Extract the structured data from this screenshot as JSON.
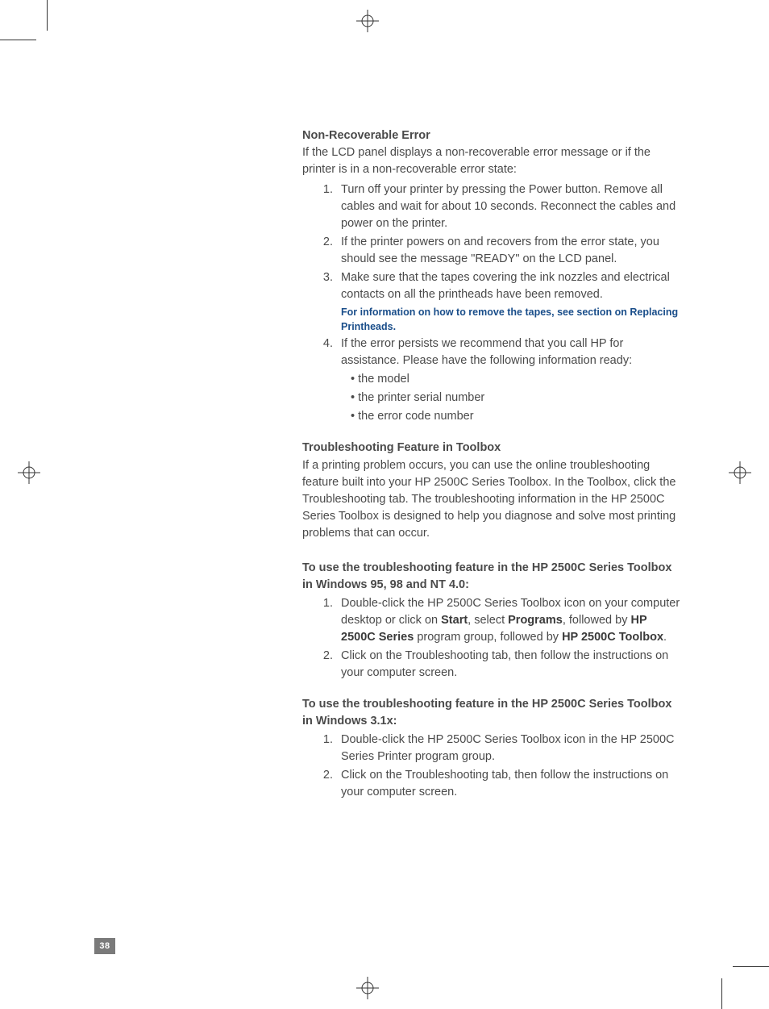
{
  "pageNumber": "38",
  "section1": {
    "heading": "Non-Recoverable Error",
    "intro": "If the LCD panel displays a non-recoverable error message or if the printer is in a non-recoverable error state:",
    "items": [
      "Turn off your printer by pressing the Power button. Remove all cables and wait for about 10 seconds. Reconnect the cables and power on the printer.",
      "If the printer powers on and recovers from the error state, you should see the message \"READY\" on the LCD panel.",
      "Make sure that the tapes covering the ink nozzles and electrical contacts on all the printheads have been removed."
    ],
    "note": "For information on how to remove the tapes, see section on Replacing Printheads.",
    "item4_lead": "If the error persists we recommend that you call HP for assistance. Please have the following information ready:",
    "bullets": [
      "the model",
      "the printer serial number",
      "the error code number"
    ]
  },
  "section2": {
    "heading": "Troubleshooting Feature in Toolbox",
    "para": "If a printing problem occurs, you can use the online troubleshooting feature built into your HP 2500C Series Toolbox. In the Toolbox, click the Troubleshooting tab. The troubleshooting information in the HP 2500C Series Toolbox is designed to help you diagnose and solve most printing problems that can occur."
  },
  "section3": {
    "heading": "To use the troubleshooting feature in the HP 2500C Series Toolbox in Windows 95, 98 and NT 4.0:",
    "item1_pre": "Double-click the HP 2500C Series Toolbox icon on your computer desktop or click on ",
    "b1": "Start",
    "mid1": ", select ",
    "b2": "Programs",
    "mid2": ", followed by ",
    "b3": "HP 2500C Series",
    "mid3": " program group, followed by ",
    "b4": "HP 2500C Toolbox",
    "end1": ".",
    "item2": "Click on the Troubleshooting tab, then follow the instructions on your computer screen."
  },
  "section4": {
    "heading": "To use the troubleshooting feature in the HP 2500C Series Toolbox in Windows 3.1x:",
    "items": [
      "Double-click the HP 2500C Series Toolbox icon in the HP 2500C Series Printer program group.",
      "Click on the Troubleshooting tab, then follow the instructions on your computer screen."
    ]
  }
}
